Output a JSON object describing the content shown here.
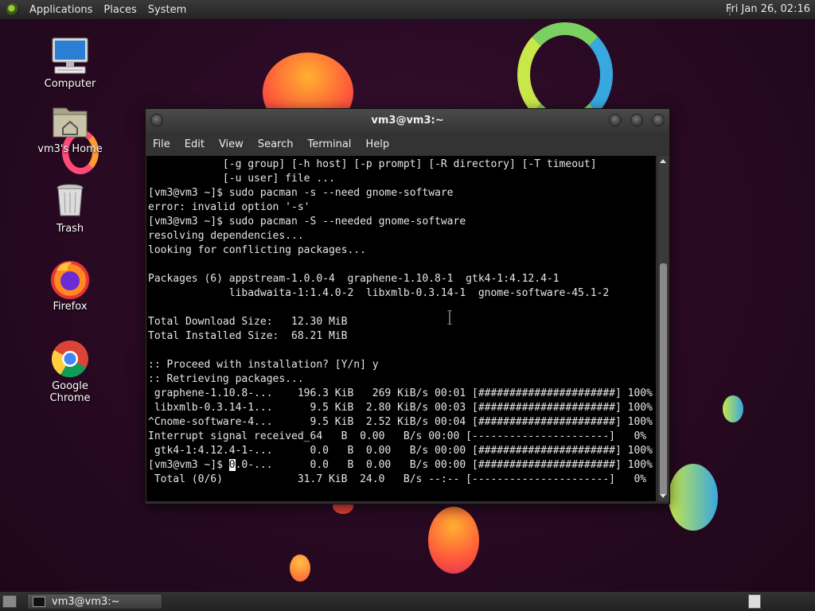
{
  "top_panel": {
    "menus": [
      "Applications",
      "Places",
      "System"
    ],
    "clock": "Fri Jan 26, 02:16"
  },
  "desktop_icons": [
    {
      "label": "Computer",
      "icon": "computer-icon"
    },
    {
      "label": "vm3's Home",
      "icon": "home-folder-icon"
    },
    {
      "label": "Trash",
      "icon": "trash-icon"
    },
    {
      "label": "Firefox",
      "icon": "firefox-icon"
    },
    {
      "label": "Google Chrome",
      "icon": "chrome-icon"
    }
  ],
  "terminal": {
    "title": "vm3@vm3:~",
    "menus": [
      "File",
      "Edit",
      "View",
      "Search",
      "Terminal",
      "Help"
    ],
    "lines": [
      "            [-g group] [-h host] [-p prompt] [-R directory] [-T timeout]",
      "            [-u user] file ...",
      "[vm3@vm3 ~]$ sudo pacman -s --need gnome-software",
      "error: invalid option '-s'",
      "[vm3@vm3 ~]$ sudo pacman -S --needed gnome-software",
      "resolving dependencies...",
      "looking for conflicting packages...",
      "",
      "Packages (6) appstream-1.0.0-4  graphene-1.10.8-1  gtk4-1:4.12.4-1",
      "             libadwaita-1:1.4.0-2  libxmlb-0.3.14-1  gnome-software-45.1-2",
      "",
      "Total Download Size:   12.30 MiB",
      "Total Installed Size:  68.21 MiB",
      "",
      ":: Proceed with installation? [Y/n] y",
      ":: Retrieving packages...",
      " graphene-1.10.8-...    196.3 KiB   269 KiB/s 00:01 [######################] 100%",
      " libxmlb-0.3.14-1...      9.5 KiB  2.80 KiB/s 00:03 [######################] 100%",
      "^Cnome-software-4...      9.5 KiB  2.52 KiB/s 00:04 [######################] 100%",
      "Interrupt signal received_64   B  0.00   B/s 00:00 [----------------------]   0%",
      " gtk4-1:4.12.4-1-...      0.0   B  0.00   B/s 00:00 [######################] 100%"
    ],
    "prompt_line_before_cursor": "[vm3@vm3 ~]$ ",
    "cursor_char": "0",
    "prompt_line_after_cursor": ".0-...      0.0   B  0.00   B/s 00:00 [######################] 100%",
    "last_line": " Total (0/6)            31.7 KiB  24.0   B/s --:-- [----------------------]   0%"
  },
  "taskbar": {
    "task_label": "vm3@vm3:~"
  }
}
